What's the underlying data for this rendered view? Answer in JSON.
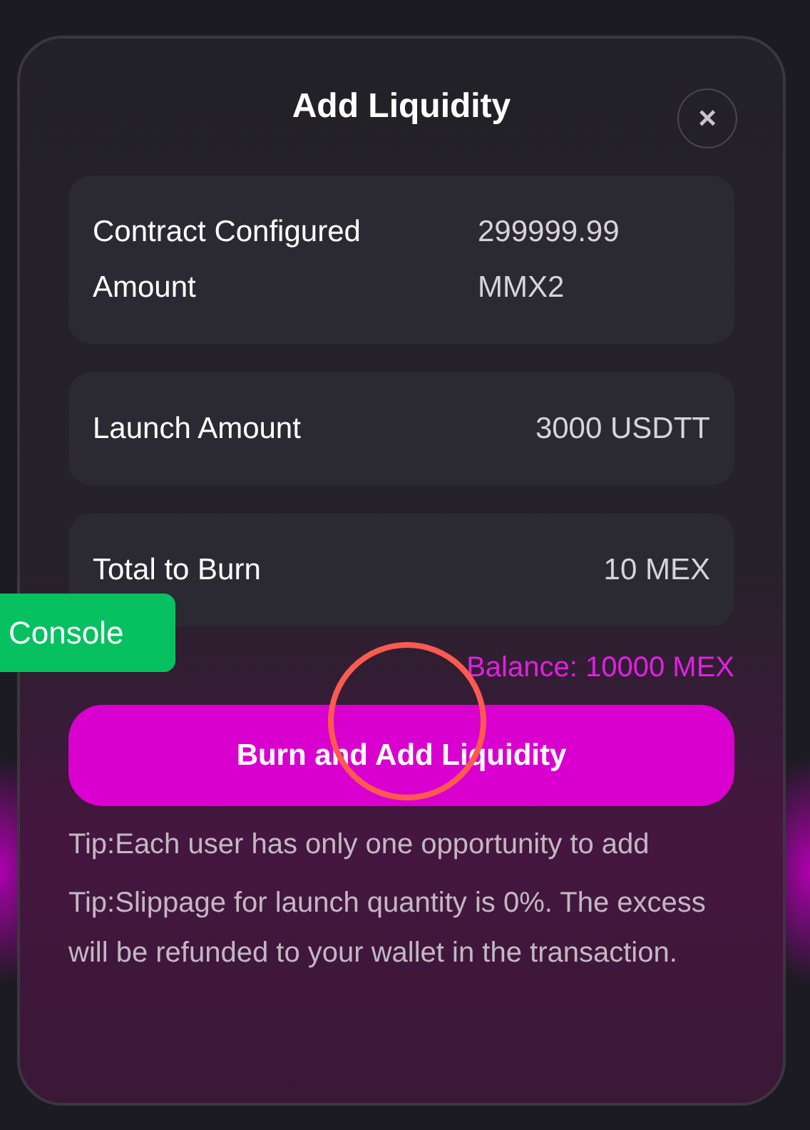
{
  "dialog": {
    "title": "Add Liquidity",
    "close": "×"
  },
  "rows": [
    {
      "label": "Contract Configured Amount",
      "value": "299999.99 MMX2"
    },
    {
      "label": "Launch Amount",
      "value": "3000 USDTT"
    },
    {
      "label": "Total to Burn",
      "value": "10 MEX"
    }
  ],
  "balance": "Balance: 10000 MEX",
  "action": "Burn and Add Liquidity",
  "tips": [
    "Tip:Each user has only one opportunity to add",
    "Tip:Slippage for launch quantity is 0%. The excess will be refunded to your wallet in the transaction."
  ],
  "console_button": "Console"
}
